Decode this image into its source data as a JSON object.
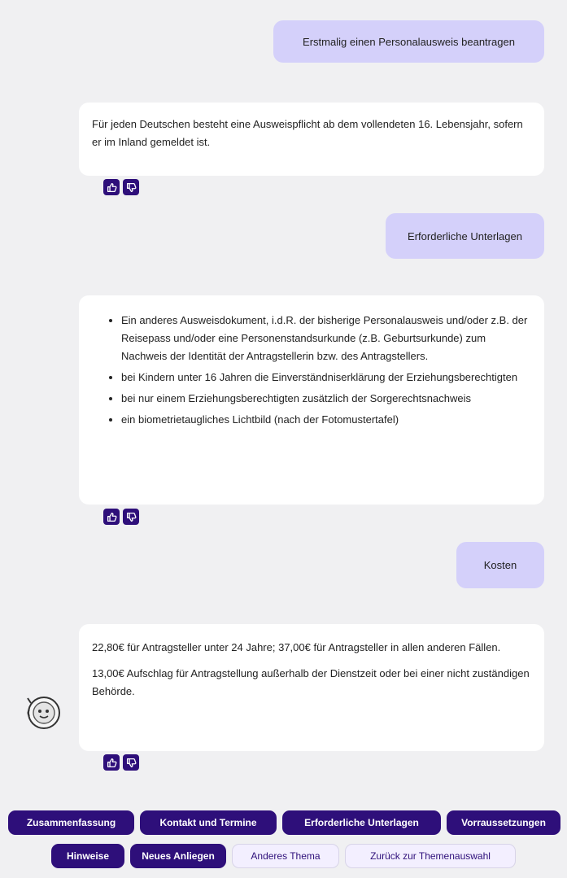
{
  "messages": [
    {
      "role": "user",
      "text": "Erstmalig einen Personalausweis beantragen"
    },
    {
      "role": "bot",
      "paragraphs": [
        "Für jeden Deutschen besteht eine Ausweispflicht ab dem vollendeten 16. Lebensjahr, sofern er im Inland gemeldet ist."
      ]
    },
    {
      "role": "user",
      "text": "Erforderliche Unterlagen"
    },
    {
      "role": "bot",
      "list": [
        "Ein anderes Ausweisdokument, i.d.R. der bisherige Personalausweis und/oder z.B. der Reisepass und/oder eine Personenstandsurkunde (z.B. Geburtsurkunde) zum Nachweis der Identität der Antragstellerin bzw. des Antragstellers.",
        "bei Kindern unter 16 Jahren die Einverständniserklärung der Erziehungsberechtigten",
        "bei nur einem Erziehungsberechtigten zusätzlich der Sorgerechtsnachweis",
        "ein biometrietaugliches Lichtbild (nach der Fotomustertafel)"
      ]
    },
    {
      "role": "user",
      "text": "Kosten"
    },
    {
      "role": "bot",
      "paragraphs": [
        "22,80€ für Antragsteller unter 24 Jahre; 37,00€ für Antragsteller in allen anderen Fällen.",
        "13,00€ Aufschlag für Antragstellung außerhalb der Dienstzeit oder bei einer nicht zuständigen Behörde."
      ]
    }
  ],
  "feedback": {
    "like_icon": "thumbs-up-icon",
    "dislike_icon": "thumbs-down-icon"
  },
  "quick_replies": {
    "row1": [
      "Zusammenfassung",
      "Kontakt und Termine",
      "Erforderliche Unterlagen",
      "Vorraussetzungen"
    ],
    "row2_primary": [
      "Hinweise",
      "Neues Anliegen"
    ],
    "row2_secondary": [
      "Anderes Thema",
      "Zurück zur Themenauswahl"
    ]
  },
  "colors": {
    "accent": "#2e0f7a",
    "user_bubble": "#d4d0fa",
    "background": "#f0f0f2"
  }
}
